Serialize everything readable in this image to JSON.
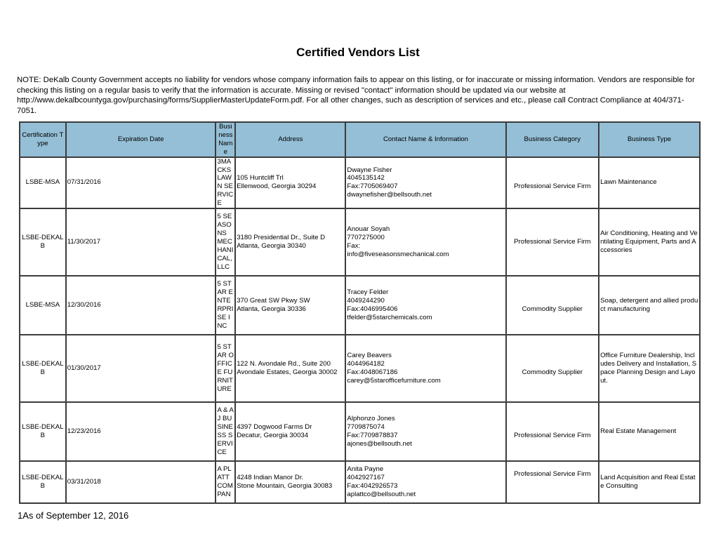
{
  "document": {
    "title": "Certified Vendors List",
    "note": "NOTE: DeKalb County Government accepts no liability for vendors whose company information fails to appear on this listing, or for inaccurate or missing information. Vendors are responsible for checking this listing on a regular basis to verify that the information is accurate. Missing or revised \"contact\" information should be updated via our website at http://www.dekalbcountyga.gov/purchasing/forms/SupplierMasterUpdateForm.pdf. For all other changes, such as description of services and etc., please call Contract Compliance at 404/371-7051.",
    "footer": "1As of September 12, 2016"
  },
  "table": {
    "header_color": "#94bfd6",
    "headers": {
      "cert": "Certification Type",
      "date": "Expiration Date",
      "name": "Business Name",
      "addr": "Address",
      "contact": "Contact Name & Information",
      "cat": "Business Category",
      "type": "Business Type"
    },
    "rows": [
      {
        "cert": "LSBE-MSA",
        "date": "07/31/2016",
        "name": "3MACKS LAWN SERVICE",
        "addr1": "105 Huntcliff Trl",
        "addr2": "Ellenwood, Georgia 30294",
        "contact_name": "Dwayne Fisher",
        "phone": "4045135142",
        "fax": "Fax:7705069407",
        "email": "dwaynefisher@bellsouth.net",
        "cat": "Professional Service Firm",
        "type": "Lawn Maintenance"
      },
      {
        "cert": "LSBE-DEKALB",
        "date": "11/30/2017",
        "name": "5 SEASONS MECHANICAL, LLC",
        "addr1": "3180 Presidential Dr., Suite D",
        "addr2": "Atlanta, Georgia 30340",
        "contact_name": "Anouar Soyah",
        "phone": "7707275000",
        "fax": "Fax:",
        "email": "info@fiveseasonsmechanical.com",
        "cat": "Professional Service Firm",
        "type": "Air Conditioning, Heating and Ventilating Equipment, Parts and Accessories"
      },
      {
        "cert": "LSBE-MSA",
        "date": "12/30/2016",
        "name": "5 STAR ENTERPRISE INC",
        "addr1": "370 Great SW Pkwy SW",
        "addr2": "Atlanta, Georgia 30336",
        "contact_name": "Tracey Felder",
        "phone": "4049244290",
        "fax": "Fax:4046995406",
        "email": "tfelder@5starchemicals.com",
        "cat": "Commodity Supplier",
        "type": "Soap, detergent and allied product manufacturing"
      },
      {
        "cert": "LSBE-DEKALB",
        "date": "01/30/2017",
        "name": "5 STAR OFFICE FURNITURE",
        "addr1": "122 N. Avondale Rd., Suite 200",
        "addr2": "Avondale Estates, Georgia 30002",
        "contact_name": "Carey Beavers",
        "phone": "4044964182",
        "fax": "Fax:4048067186",
        "email": "carey@5starofficefurniture.com",
        "cat": "Commodity Supplier",
        "type": "Office Furniture Dealership, Includes Delivery and Installation, Space Planning Design and Layout."
      },
      {
        "cert": "LSBE-DEKALB",
        "date": "12/23/2016",
        "name": "A & AJ BUSINESS SERVICE",
        "addr1": "4397 Dogwood Farms Dr",
        "addr2": "Decatur, Georgia 30034",
        "contact_name": "Alphonzo Jones",
        "phone": "7709875074",
        "fax": "Fax:7709878837",
        "email": "ajones@bellsouth.net",
        "cat": "Professional Service Firm",
        "type": "Real Estate Management"
      },
      {
        "cert": "LSBE-DEKALB",
        "date": "03/31/2018",
        "name": "A PLATT COMPAN",
        "addr1": "4248 Indian Manor Dr.",
        "addr2": "Stone Mountain, Georgia 30083",
        "contact_name": "Anita Payne",
        "phone": "4042927167",
        "fax": "Fax:4042926573",
        "email": "aplattco@bellsouth.net",
        "cat": "Professional Service Firm",
        "type": "Land Acquisition and Real Estate Consulting"
      }
    ]
  }
}
